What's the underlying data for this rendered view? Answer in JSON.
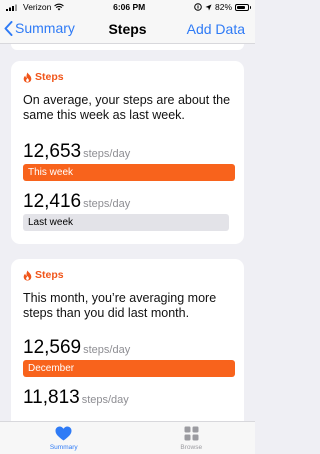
{
  "status_bar": {
    "carrier": "Verizon",
    "time": "6:06 PM",
    "battery": "82%",
    "battery_level": 0.82
  },
  "nav": {
    "back_label": "Summary",
    "title": "Steps",
    "action_label": "Add Data"
  },
  "cards": [
    {
      "category": "Steps",
      "headline": "On average, your steps are about the same this week as last week.",
      "current": {
        "value": "12,653",
        "unit": "steps/day",
        "label": "This week"
      },
      "previous": {
        "value": "12,416",
        "unit": "steps/day",
        "label": "Last week"
      }
    },
    {
      "category": "Steps",
      "headline": "This month, you’re averaging more steps than you did last month.",
      "current": {
        "value": "12,569",
        "unit": "steps/day",
        "label": "December"
      },
      "previous": {
        "value": "11,813",
        "unit": "steps/day"
      }
    }
  ],
  "tabs": [
    {
      "label": "Summary",
      "active": true
    },
    {
      "label": "Browse",
      "active": false
    }
  ],
  "colors": {
    "accent": "#2f7bf6",
    "steps_orange": "#f8631c",
    "bar_gray": "#e3e3e8"
  }
}
